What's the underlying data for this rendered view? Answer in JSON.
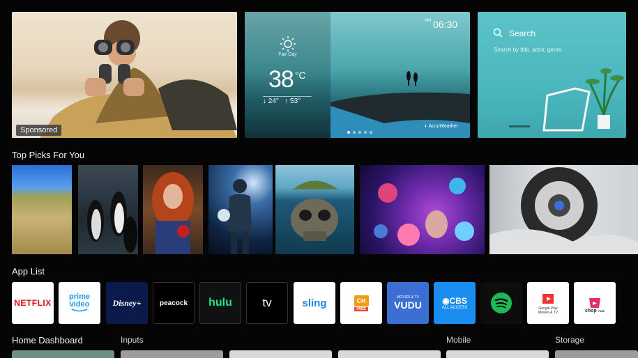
{
  "hero": {
    "badge": "Sponsored"
  },
  "weather": {
    "condition": "Fair Day",
    "temperature": "38",
    "unit": "°C",
    "low": "↓ 24°",
    "high": "↑ 53°",
    "ampm": "PM",
    "time": "06:30",
    "provider": "AccuWeather",
    "page_dots": 5,
    "active_dot": 0
  },
  "search": {
    "title": "Search",
    "hint": "Search by title, actor, genre."
  },
  "top_picks": {
    "label": "Top Picks For You",
    "items": [
      "wheat-field",
      "penguins",
      "red-haired-woman",
      "soccer-player",
      "island-skull",
      "flower-portrait",
      "spinning-tire"
    ]
  },
  "app_list": {
    "label": "App List",
    "apps": [
      {
        "id": "netflix",
        "label": "NETFLIX",
        "bg": "#ffffff",
        "fg": "#e50914"
      },
      {
        "id": "prime-video",
        "label": "prime video",
        "bg": "#ffffff",
        "fg": "#1a98ff"
      },
      {
        "id": "disney-plus",
        "label": "Disney+",
        "bg": "#0c1a4b",
        "fg": "#ffffff"
      },
      {
        "id": "peacock",
        "label": "peacock",
        "bg": "#000000",
        "fg": "#ffffff"
      },
      {
        "id": "hulu",
        "label": "hulu",
        "bg": "#111111",
        "fg": "#1ce783"
      },
      {
        "id": "apple-tv",
        "label": "tv",
        "bg": "#000000",
        "fg": "#ffffff"
      },
      {
        "id": "sling",
        "label": "sling",
        "bg": "#ffffff",
        "fg": "#1e88e5"
      },
      {
        "id": "channel-plus",
        "label": "CH",
        "sublabel": "FREE",
        "bg": "#ffffff",
        "fg": "#f39c12"
      },
      {
        "id": "vudu",
        "label": "VUDU",
        "sublabel": "MOVIES & TV",
        "bg": "#3b6fd4",
        "fg": "#ffffff"
      },
      {
        "id": "cbs",
        "label": "CBS",
        "sublabel": "ALL ACCESS",
        "bg": "#1a8ef0",
        "fg": "#ffffff"
      },
      {
        "id": "spotify",
        "label": "",
        "bg": "#0d0d0d",
        "fg": "#1db954"
      },
      {
        "id": "google-play-movies",
        "label": "Google Play",
        "sublabel": "Movies & TV",
        "bg": "#ffffff",
        "fg": "#e33"
      },
      {
        "id": "shop-time",
        "label": "shop",
        "sublabel": "TIME",
        "bg": "#ffffff",
        "fg": "#e02f6b"
      }
    ]
  },
  "dashboard": {
    "home": "Home Dashboard",
    "inputs": "Inputs",
    "mobile": "Mobile",
    "storage": "Storage"
  }
}
